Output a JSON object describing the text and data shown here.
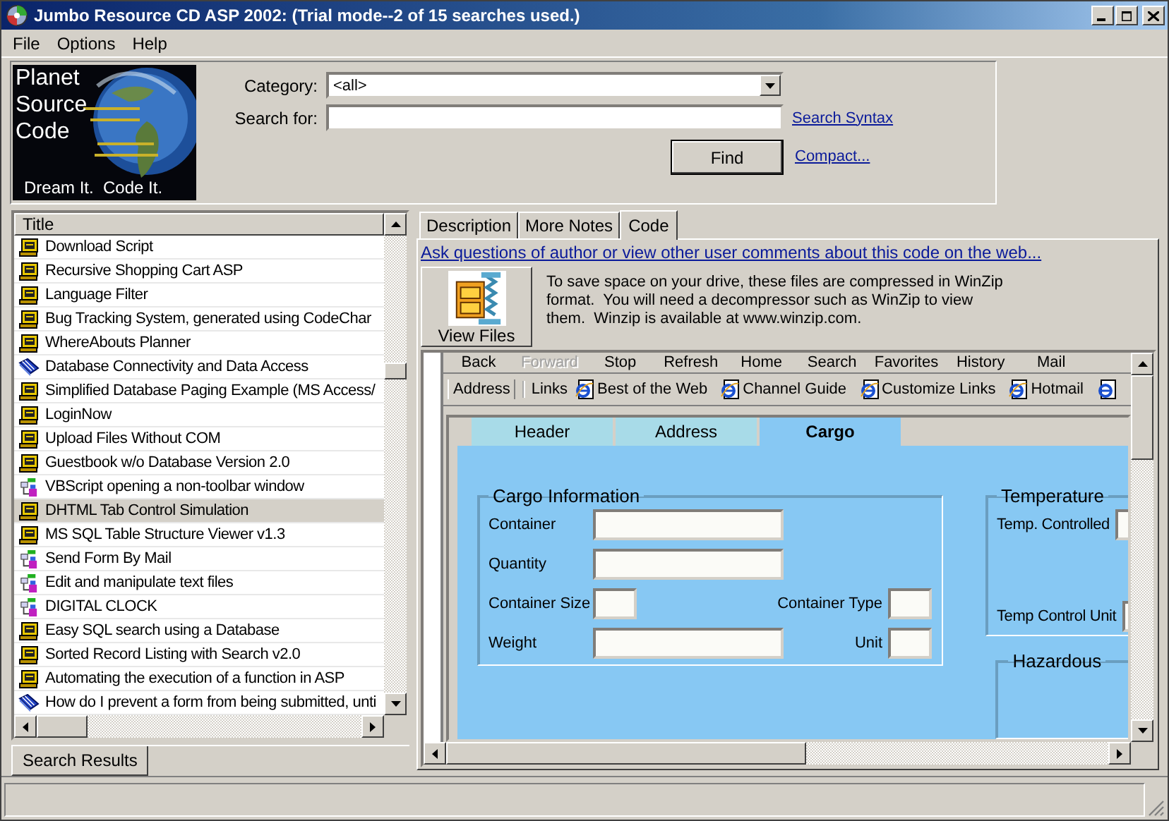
{
  "window": {
    "title": "Jumbo Resource CD ASP 2002: (Trial mode--2 of 15 searches used.)"
  },
  "menu": [
    "File",
    "Options",
    "Help"
  ],
  "logo": {
    "lines": [
      "Planet",
      "Source",
      "Code"
    ],
    "tagline": "Dream It.  Code It."
  },
  "search": {
    "category_label": "Category:",
    "category_value": "<all>",
    "search_label": "Search for:",
    "syntax_link": "Search Syntax",
    "find_button": "Find",
    "compact_link": "Compact..."
  },
  "results": {
    "column": "Title",
    "tab": "Search Results",
    "rows": [
      {
        "title": "Download Script",
        "kind": "sql",
        "selected": false
      },
      {
        "title": "Recursive Shopping Cart ASP",
        "kind": "sql",
        "selected": false
      },
      {
        "title": "Language Filter",
        "kind": "sql",
        "selected": false
      },
      {
        "title": "Bug Tracking System, generated using CodeChar",
        "kind": "sql",
        "selected": false
      },
      {
        "title": "WhereAbouts Planner",
        "kind": "sql",
        "selected": false
      },
      {
        "title": "Database Connectivity and Data Access",
        "kind": "db",
        "selected": false
      },
      {
        "title": "Simplified Database Paging Example (MS Access/",
        "kind": "sql",
        "selected": false
      },
      {
        "title": "LoginNow",
        "kind": "sql",
        "selected": false
      },
      {
        "title": "Upload Files Without COM",
        "kind": "sql",
        "selected": false
      },
      {
        "title": "Guestbook w/o Database Version 2.0",
        "kind": "sql",
        "selected": false
      },
      {
        "title": "VBScript opening a non-toolbar window",
        "kind": "vb",
        "selected": false
      },
      {
        "title": "DHTML Tab Control Simulation",
        "kind": "sql",
        "selected": true
      },
      {
        "title": "MS SQL Table Structure Viewer v1.3",
        "kind": "sql",
        "selected": false
      },
      {
        "title": "Send Form By Mail",
        "kind": "vb",
        "selected": false
      },
      {
        "title": "Edit and manipulate text files",
        "kind": "vb",
        "selected": false
      },
      {
        "title": "DIGITAL CLOCK",
        "kind": "vb",
        "selected": false
      },
      {
        "title": "Easy SQL search using a Database",
        "kind": "sql",
        "selected": false
      },
      {
        "title": "Sorted Record Listing with Search v2.0",
        "kind": "sql",
        "selected": false
      },
      {
        "title": "Automating the execution of a function in ASP",
        "kind": "sql",
        "selected": false
      },
      {
        "title": "How do I prevent a form from being submitted, unti",
        "kind": "db",
        "selected": false
      }
    ]
  },
  "detail": {
    "tabs": [
      {
        "label": "Description",
        "selected": false
      },
      {
        "label": "More Notes",
        "selected": false
      },
      {
        "label": "Code",
        "selected": true
      }
    ],
    "comments_link": "Ask questions of author or view other user comments about this code on the web...",
    "view_files_button": "View Files",
    "note": "To save space on your drive, these files are compressed in WinZip format.  You will need a decompressor such as WinZip to view them.  Winzip is available at www.winzip.com.",
    "browser": {
      "toolbar": [
        {
          "label": "Back",
          "disabled": false
        },
        {
          "label": "Forward",
          "disabled": true
        },
        {
          "label": "Stop",
          "disabled": false
        },
        {
          "label": "Refresh",
          "disabled": false
        },
        {
          "label": "Home",
          "disabled": false
        },
        {
          "label": "Search",
          "disabled": false
        },
        {
          "label": "Favorites",
          "disabled": false
        },
        {
          "label": "History",
          "disabled": false
        },
        {
          "label": "Mail",
          "disabled": false
        }
      ],
      "address_label": "Address",
      "links_label": "Links",
      "links": [
        "Best of the Web",
        "Channel Guide",
        "Customize Links",
        "Hotmail"
      ],
      "page": {
        "tabs": [
          {
            "label": "Header",
            "selected": false
          },
          {
            "label": "Address",
            "selected": false
          },
          {
            "label": "Cargo",
            "selected": true
          }
        ],
        "cargo": {
          "title": "Cargo Information",
          "rows": [
            {
              "fields": [
                {
                  "label": "Container",
                  "kind": "wide"
                }
              ]
            },
            {
              "fields": [
                {
                  "label": "Quantity",
                  "kind": "wide"
                }
              ]
            },
            {
              "fields": [
                {
                  "label": "Container Size",
                  "kind": "small"
                },
                {
                  "label": "Container Type",
                  "kind": "small"
                }
              ]
            },
            {
              "fields": [
                {
                  "label": "Weight",
                  "kind": "wide"
                },
                {
                  "label": "Unit",
                  "kind": "small"
                }
              ]
            }
          ]
        },
        "temperature": {
          "title": "Temperature",
          "fields": [
            "Temp. Controlled",
            "Temp Control Unit"
          ]
        },
        "hazardous": {
          "title": "Hazardous"
        }
      }
    }
  }
}
